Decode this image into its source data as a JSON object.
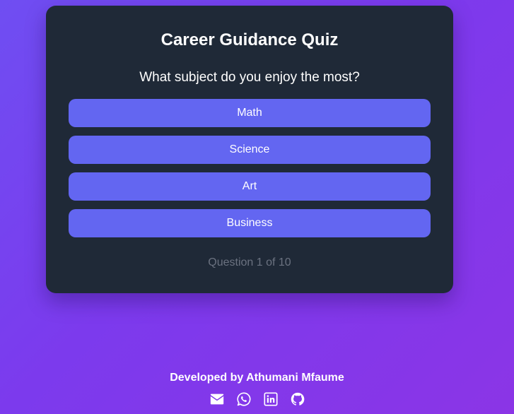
{
  "quiz": {
    "title": "Career Guidance Quiz",
    "question": "What subject do you enjoy the most?",
    "options": [
      {
        "label": "Math"
      },
      {
        "label": "Science"
      },
      {
        "label": "Art"
      },
      {
        "label": "Business"
      }
    ],
    "progress_text": "Question 1 of 10"
  },
  "footer": {
    "credit": "Developed by Athumani Mfaume",
    "socials": [
      {
        "icon": "envelope-icon"
      },
      {
        "icon": "whatsapp-icon"
      },
      {
        "icon": "linkedin-icon"
      },
      {
        "icon": "github-icon"
      }
    ]
  },
  "colors": {
    "background_start": "#6f4ef2",
    "background_end": "#8b35e6",
    "card": "#1f2937",
    "option_button": "#6366f1",
    "progress_text": "#6b7280",
    "text": "#ffffff"
  }
}
